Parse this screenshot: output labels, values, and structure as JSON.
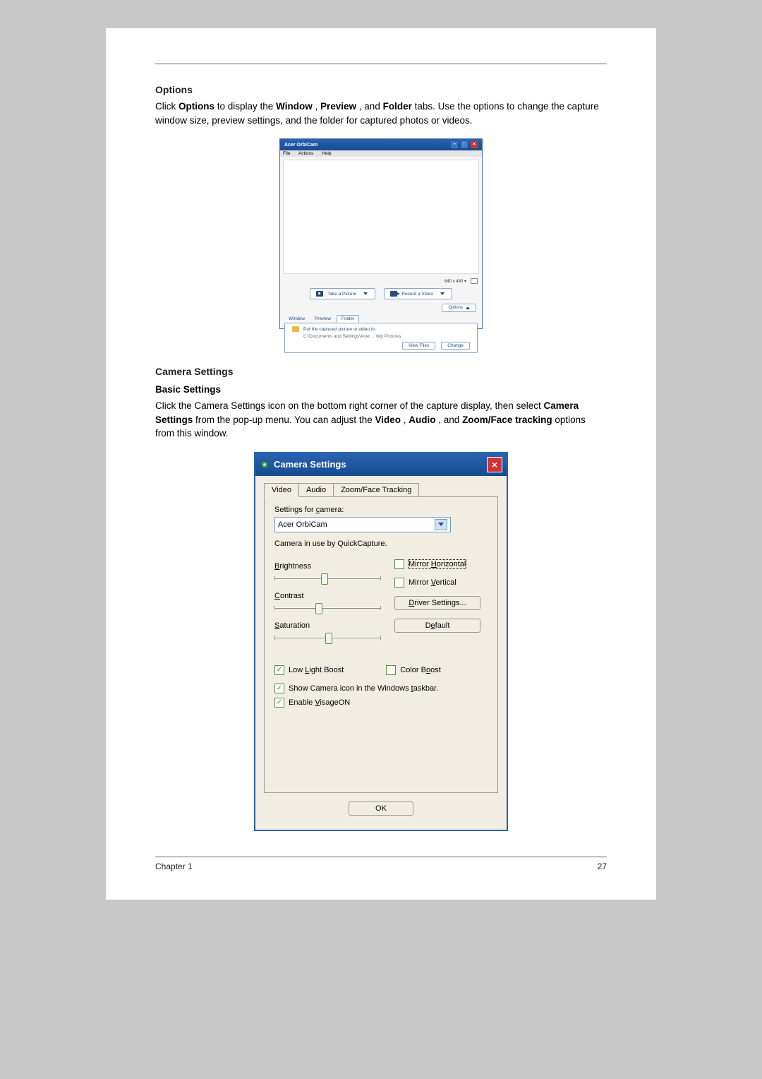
{
  "section1": {
    "heading": "Options",
    "para_pre": "Click ",
    "para_b1": "Options",
    "para_mid1": " to display the ",
    "para_b2": "Window",
    "para_mid2": ", ",
    "para_b3": "Preview",
    "para_mid3": ", and ",
    "para_b4": "Folder",
    "para_tail": " tabs. Use the options to change the capture window size, preview settings, and the folder for captured photos or videos."
  },
  "orbicam": {
    "title": "Acer OrbiCam",
    "menu": {
      "file": "File",
      "actions": "Actions",
      "help": "Help"
    },
    "resolution": "640 x 480 ▾",
    "takePicture": "Take a Picture",
    "recordVideo": "Record a Video",
    "options": "Options",
    "tabs": {
      "window": "Window",
      "preview": "Preview",
      "folder": "Folder"
    },
    "folderText": "Put the captured picture or video in:",
    "folderPath": "C:\\Documents and Settings\\Acer… \\My Pictures",
    "viewFiles": "View Files",
    "change": "Change"
  },
  "section2": {
    "h1": "Camera Settings",
    "h2": "Basic Settings",
    "para_pre": "Click the Camera Settings icon on the bottom right corner of the capture display, then select ",
    "para_b1": "Camera Settings",
    "para_mid1": " from the pop-up menu. You can adjust the ",
    "para_b2": "Video",
    "para_mid2": ", ",
    "para_b3": "Audio",
    "para_mid3": ", and ",
    "para_b4": "Zoom/Face tracking",
    "para_tail": " options from this window."
  },
  "camset": {
    "title": "Camera Settings",
    "closeX": "×",
    "tabs": {
      "video": "Video",
      "audio": "Audio",
      "zoom": "Zoom/Face Tracking"
    },
    "settingsFor_pre": "Settings for ",
    "settingsFor_u": "c",
    "settingsFor_post": "amera:",
    "cameraName": "Acer OrbiCam",
    "inUse": "Camera in use by QuickCapture.",
    "brightness_u": "B",
    "brightness_post": "rightness",
    "contrast_u": "C",
    "contrast_post": "ontrast",
    "saturation_u": "S",
    "saturation_post": "aturation",
    "mirrorH_pre": "Mirror ",
    "mirrorH_u": "H",
    "mirrorH_post": "orizontal",
    "mirrorV_pre": "Mirror ",
    "mirrorV_u": "V",
    "mirrorV_post": "ertical",
    "driver_u": "D",
    "driver_post": "river Settings...",
    "default_pre": "D",
    "default_u": "e",
    "default_post": "fault",
    "lowLight_pre": "Low ",
    "lowLight_u": "L",
    "lowLight_post": "ight Boost",
    "colorBoost_pre": "Color B",
    "colorBoost_u": "o",
    "colorBoost_post": "ost",
    "showIcon_pre": "Show Camera icon in the Windows ",
    "showIcon_u": "t",
    "showIcon_post": "askbar.",
    "enableV_pre": "Enable ",
    "enableV_u": "V",
    "enableV_post": "isageON",
    "ok": "OK"
  },
  "footer": {
    "left": "Chapter 1",
    "right": "27"
  }
}
